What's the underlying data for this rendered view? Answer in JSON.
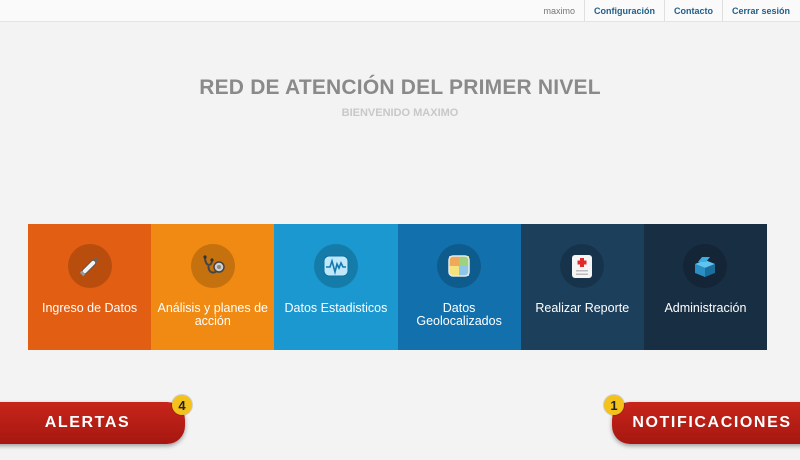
{
  "topbar": {
    "username": "maximo",
    "settings_label": "Configuración",
    "contact_label": "Contacto",
    "logout_label": "Cerrar sesión"
  },
  "header": {
    "title": "RED DE ATENCIÓN DEL PRIMER NIVEL",
    "subtitle": "BIENVENIDO MAXIMO"
  },
  "tiles": [
    {
      "label": "Ingreso de Datos",
      "icon": "pen-icon",
      "color": "#e25e12"
    },
    {
      "label": "Análisis y planes de acción",
      "icon": "stethoscope-icon",
      "color": "#f18a12"
    },
    {
      "label": "Datos Estadisticos",
      "icon": "heartbeat-chart-icon",
      "color": "#1a98cf"
    },
    {
      "label": "Datos Geolocalizados",
      "icon": "map-icon",
      "color": "#1270ad"
    },
    {
      "label": "Realizar Reporte",
      "icon": "medical-report-icon",
      "color": "#1c3f5c"
    },
    {
      "label": "Administración",
      "icon": "admin-box-icon",
      "color": "#182e42"
    }
  ],
  "alerts": {
    "label": "ALERTAS",
    "count": "4"
  },
  "notifications": {
    "label": "NOTIFICACIONES",
    "count": "1"
  }
}
